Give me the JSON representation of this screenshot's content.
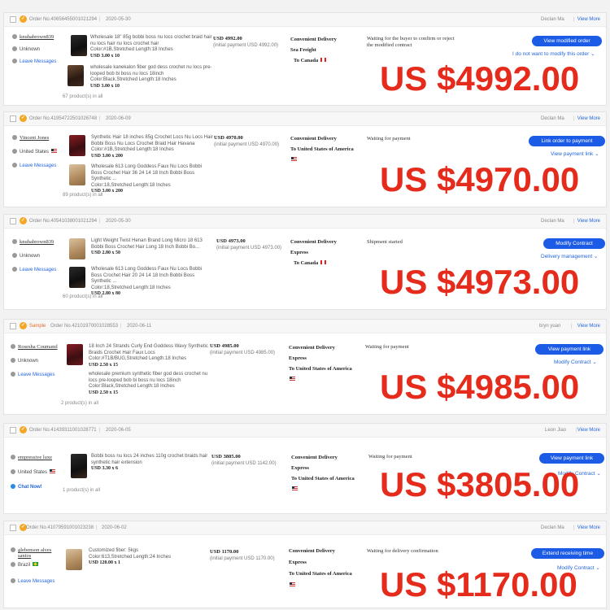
{
  "orders": [
    {
      "order_no": "Order No.40656455001021294",
      "date": "2020-05-30",
      "seller": "Declan Ma",
      "view_more": "View More",
      "buyer_name": "knuhabrown839",
      "buyer_country": "Unknown",
      "buyer_action": "Leave Messages",
      "items": [
        {
          "title": "Wholesale 18\" 85g bobbi boss nu locs crochet braid hair nu locs hair nu locs crochet hair",
          "attrs": "Color:#1B,Stretched Length:18 Inches",
          "price": "USD 3.00 x 10"
        },
        {
          "title": "wholesale kanekalon fiber god dess crochet nu locs pre-looped bob bi boss nu locs 18inch",
          "attrs": "Color:Black,Stretched Length:18 Inches",
          "price": "USD 3.00 x 10"
        }
      ],
      "products_count": "67 product(s) in all",
      "amount": "USD 4992.00",
      "initial_payment": "(initial payment USD 4992.00)",
      "ship_method": "Convenient Delivery",
      "ship_line2": "Sea Freight",
      "destination": "To Canada",
      "status": "Waiting for the buyer to confirm or reject the modified contract",
      "button": "View modified order",
      "secondary_link": "I do not want to modify this order",
      "overlay_total": "US $4992.00"
    },
    {
      "order_no": "Order No.41954722501026748",
      "date": "2020-06-09",
      "seller": "Declan Ma",
      "view_more": "View More",
      "buyer_name": "Vincent Jones",
      "buyer_country": "United States",
      "buyer_action": "Leave Messages",
      "items": [
        {
          "title": "Synthetic Hair 18 inches 85g Crochet Locs Nu Locs Hair Bobbi Boss Nu Locs Crochet Braid Hair Havana",
          "attrs": "Color:#1B,Stretched Length:18 Inches",
          "price": "USD 3.00 x 200"
        },
        {
          "title": "Wholesale 613 Long Goddess Faux Nu Locs Bobbi Boss Crochet Hair 36 24 14 18 Inch Bobbi Boss Synthetic ...",
          "attrs": "Color:18,Stretched Length:18 Inches",
          "price": "USD 3.00 x 200"
        }
      ],
      "products_count": "89 product(s) in all",
      "amount": "USD 4970.00",
      "initial_payment": "(initial payment USD 4970.00)",
      "ship_method": "Convenient Delivery",
      "ship_line2": "",
      "destination": "To United States of America",
      "status": "Waiting for payment",
      "button": "Link order to payment",
      "secondary_link": "View payment link",
      "overlay_total": "US $4970.00"
    },
    {
      "order_no": "Order No.40541038001021294",
      "date": "2020-05-30",
      "seller": "Declan Ma",
      "view_more": "View More",
      "buyer_name": "knuhabrown839",
      "buyer_country": "Unknown",
      "buyer_action": "Leave Messages",
      "items": [
        {
          "title": "Light Weight Twist Henan Brand Long Micro 18 613 Bobbi Boss Crochet Hair Long 18 Inch Bobbi Bo...",
          "attrs": "",
          "price": "USD 2.80 x 50"
        },
        {
          "title": "Wholesale 613 Long Goddess Faux Nu Locs Bobbi Boss Crochet Hair 20 24 14 18 Inch Bobbi Boss Synthetic ...",
          "attrs": "Color:18,Stretched Length:18 Inches",
          "price": "USD 2.80 x 80"
        }
      ],
      "products_count": "60 product(s) in all",
      "amount": "USD 4973.00",
      "initial_payment": "(initial payment USD 4973.00)",
      "ship_method": "Convenient Delivery",
      "ship_line2": "Express",
      "destination": "To Canada",
      "status": "Shipment started",
      "button": "Modify Contract",
      "secondary_link": "Delivery management",
      "overlay_total": "US $4973.00"
    },
    {
      "sample_label": "Sample",
      "order_no": "Order No.42101970001028553",
      "date": "2020-06-11",
      "seller": "bryn yuan",
      "view_more": "View More",
      "buyer_name": "Rosesha Coumand",
      "buyer_country": "Unknown",
      "buyer_action": "Leave Messages",
      "items": [
        {
          "title": "18 Inch 24 Strands Curly End Goddess Wavy Synthetic Braids Crochet Hair Faux Locs",
          "attrs": "Color:#T1B/BUG,Stretched Length:18 Inches",
          "price": "USD 2.50 x 15"
        },
        {
          "title": "wholesale premium synthetic fiber god dess crochet nu locs pre-looped bob bi boss nu locs 18inch",
          "attrs": "Color:Black,Stretched Length:18 Inches",
          "price": "USD 2.50 x 15"
        }
      ],
      "products_count": "2 product(s) in all",
      "amount": "USD 4985.00",
      "initial_payment": "(initial payment USD 4985.00)",
      "ship_method": "Convenient Delivery",
      "ship_line2": "Express",
      "destination": "To United States of America",
      "status": "Waiting for payment",
      "button": "View payment link",
      "secondary_link": "Modify Contract",
      "overlay_total": "US $4985.00"
    },
    {
      "order_no": "Order No.41439311001028771",
      "date": "2020-06-05",
      "seller": "Leon Jiao",
      "view_more": "View More",
      "buyer_name": "empressive luxe",
      "buyer_country": "United States",
      "buyer_action": "Chat Now!",
      "items": [
        {
          "title": "Bobbi boss nu locs 24 inches 110g crochet braids hair synthetic hair extension",
          "attrs": "",
          "price": "USD 3.30 x 6"
        }
      ],
      "products_count": "1 product(s) in all",
      "amount": "USD 3805.00",
      "initial_payment": "(initial payment USD 1142.00)",
      "ship_method": "Convenient Delivery",
      "ship_line2": "Express",
      "destination": "To United States of America",
      "status": "Waiting for payment",
      "button": "View payment link",
      "secondary_link": "Modify Contract",
      "overlay_total": "US $3805.00"
    },
    {
      "order_no": "Order No.41079591001023238",
      "date": "2020-06-02",
      "seller": "Declan Ma",
      "view_more": "View More",
      "buyer_name": "glebenson alves santos",
      "buyer_country": "Brazil",
      "buyer_action": "Leave Messages",
      "items": [
        {
          "title": "Customized fiber: 5kgs",
          "attrs": "Color:613,Stretched Length:24 Inches",
          "price": "USD 120.00 x 1"
        }
      ],
      "products_count": "",
      "amount": "USD 1170.00",
      "initial_payment": "(initial payment USD 1170.00)",
      "ship_method": "Convenient Delivery",
      "ship_line2": "Express",
      "destination": "To United States of America",
      "status": "Waiting for delivery confirmation",
      "button": "Extend receiving time",
      "secondary_link": "Modify Contract",
      "overlay_total": "US $1170.00"
    }
  ]
}
